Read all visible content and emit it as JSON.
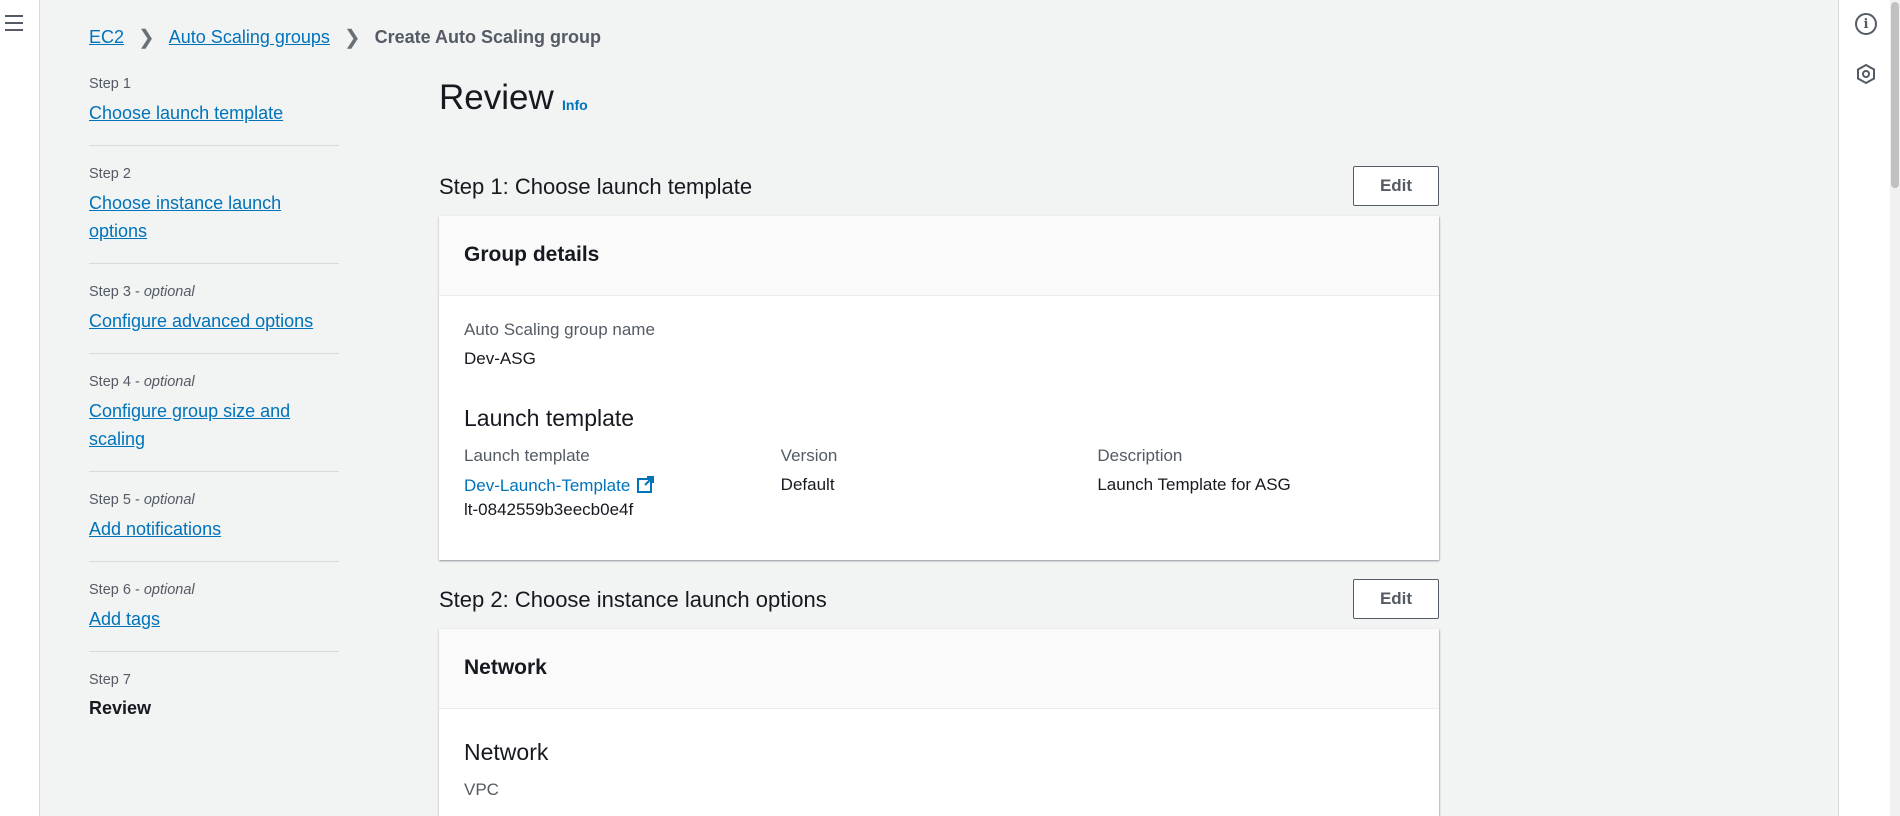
{
  "breadcrumb": {
    "items": [
      "EC2",
      "Auto Scaling groups"
    ],
    "current": "Create Auto Scaling group"
  },
  "steps": [
    {
      "num": "Step 1",
      "optional": "",
      "label": "Choose launch template"
    },
    {
      "num": "Step 2",
      "optional": "",
      "label": "Choose instance launch options"
    },
    {
      "num": "Step 3",
      "optional": "optional",
      "label": "Configure advanced options"
    },
    {
      "num": "Step 4",
      "optional": "optional",
      "label": "Configure group size and scaling"
    },
    {
      "num": "Step 5",
      "optional": "optional",
      "label": "Add notifications"
    },
    {
      "num": "Step 6",
      "optional": "optional",
      "label": "Add tags"
    },
    {
      "num": "Step 7",
      "optional": "",
      "label": "Review"
    }
  ],
  "page": {
    "title": "Review",
    "info": "Info"
  },
  "section1": {
    "title": "Step 1: Choose launch template",
    "edit": "Edit",
    "card_title": "Group details",
    "asg_name_label": "Auto Scaling group name",
    "asg_name_value": "Dev-ASG",
    "lt_heading": "Launch template",
    "lt_label": "Launch template",
    "lt_name": "Dev-Launch-Template",
    "lt_id": "lt-0842559b3eecb0e4f",
    "version_label": "Version",
    "version_value": "Default",
    "desc_label": "Description",
    "desc_value": "Launch Template for ASG"
  },
  "section2": {
    "title": "Step 2: Choose instance launch options",
    "edit": "Edit",
    "card_title": "Network",
    "network_heading": "Network",
    "vpc_label": "VPC"
  },
  "colors": {
    "link": "#0073bb",
    "background": "#f2f3f3",
    "card_header": "#fafafa"
  }
}
